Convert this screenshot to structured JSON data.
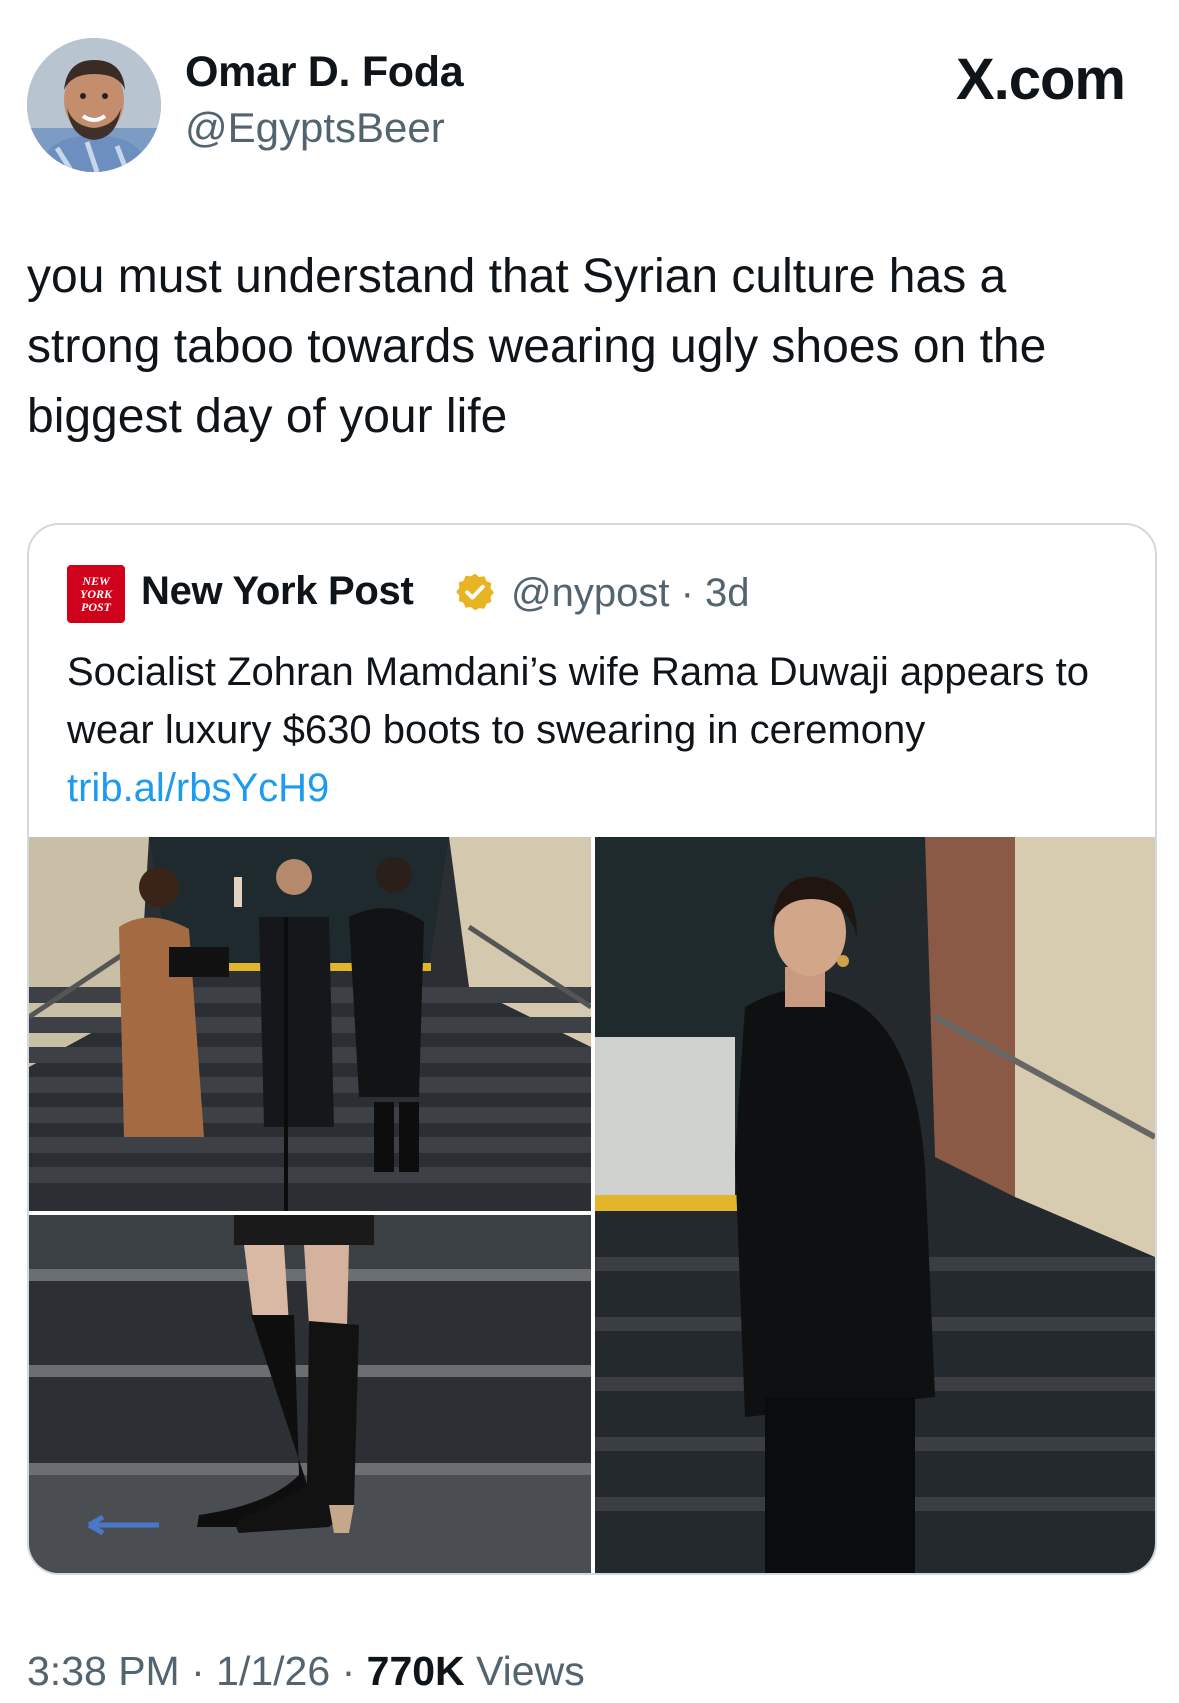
{
  "tweet": {
    "author": {
      "name": "Omar D. Foda",
      "handle": "@EgyptsBeer",
      "avatar_icon": "profile-photo"
    },
    "site_label": "X.com",
    "text": "you must understand that Syrian culture has a strong taboo towards wearing ugly shoes on the biggest day of your life",
    "time": "3:38 PM",
    "date": "1/1/26",
    "views_count": "770K",
    "views_label": "Views",
    "separator": "·"
  },
  "quoted": {
    "logo_text": [
      "NEW",
      "YORK",
      "POST"
    ],
    "name": "New York Post",
    "verified_icon": "gold-verified-badge-icon",
    "handle": "@nypost",
    "age": "3d",
    "text": "Socialist Zohran Mamdani’s wife Rama Duwaji appears to wear luxury $630 boots to swearing in ceremony",
    "link": "trib.al/rbsYcH9",
    "images": [
      {
        "icon": "swearing-in-ceremony-photo"
      },
      {
        "icon": "black-boots-closeup-photo"
      },
      {
        "icon": "woman-in-black-coat-photo"
      }
    ]
  },
  "colors": {
    "text": "#0f1419",
    "secondary": "#536471",
    "link": "#1d9bf0",
    "border": "#cfd9de",
    "nypost_red": "#d0021b",
    "verified_gold": "#e8b423"
  }
}
